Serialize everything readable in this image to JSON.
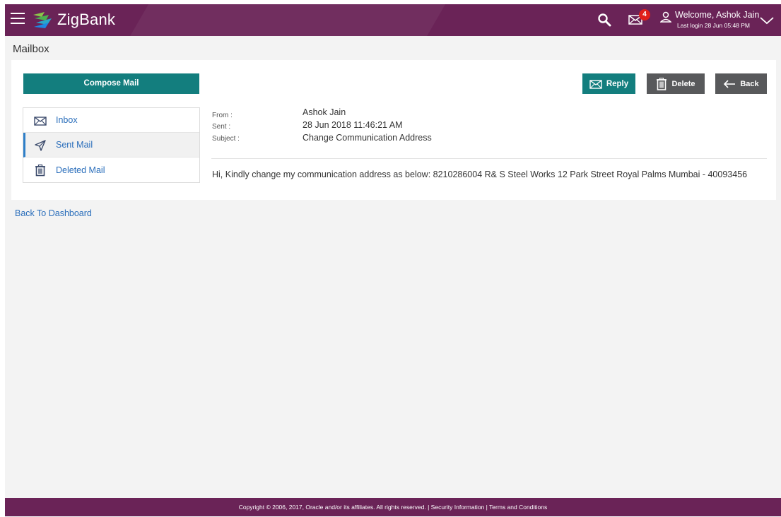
{
  "header": {
    "brand": "ZigBank",
    "notification_count": "4",
    "welcome_text": "Welcome, Ashok Jain",
    "last_login": "Last login 28 Jun 05:48 PM",
    "colors": {
      "bar": "#6a2357",
      "badge": "#e0201b"
    },
    "icons": [
      "menu-icon",
      "zigbank-logo-icon",
      "search-icon",
      "mail-icon",
      "user-icon",
      "chevron-down-icon"
    ]
  },
  "page": {
    "title": "Mailbox"
  },
  "sidebar": {
    "compose_label": "Compose Mail",
    "folders": [
      {
        "label": "Inbox",
        "icon": "mail-icon",
        "active": false
      },
      {
        "label": "Sent Mail",
        "icon": "paper-plane-icon",
        "active": true
      },
      {
        "label": "Deleted Mail",
        "icon": "trash-icon",
        "active": false
      }
    ]
  },
  "actions": {
    "reply_label": "Reply",
    "delete_label": "Delete",
    "back_label": "Back",
    "colors": {
      "primary": "#137e7e",
      "secondary": "#58595b"
    }
  },
  "message": {
    "from_label": "From :",
    "from_value": "Ashok Jain",
    "sent_label": "Sent :",
    "sent_value": "28 Jun 2018 11:46:21 AM",
    "subject_label": "Subject :",
    "subject_value": "Change Communication Address",
    "body": "Hi, Kindly change my communication address as below: 8210286004 R& S Steel Works 12 Park Street Royal Palms Mumbai - 40093456"
  },
  "links": {
    "back_to_dashboard": "Back To Dashboard"
  },
  "footer": {
    "text": "Copyright © 2006, 2017, Oracle and/or its affiliates. All rights reserved. | Security Information | Terms and Conditions"
  }
}
